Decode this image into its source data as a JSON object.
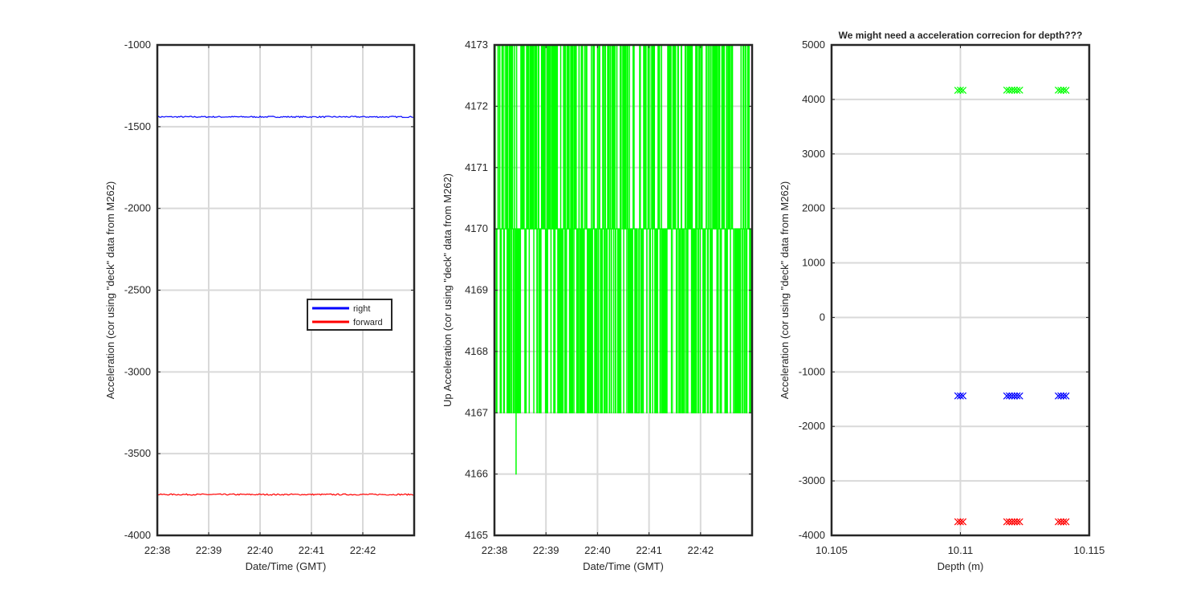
{
  "chart_data": [
    {
      "type": "line",
      "title": "",
      "xlabel": "Date/Time (GMT)",
      "ylabel": "Acceleration (cor using \"deck\" data from M262)",
      "x_ticks": [
        "22:38",
        "22:39",
        "22:40",
        "22:41",
        "22:42"
      ],
      "xlim": [
        "22:38",
        "22:43"
      ],
      "ylim": [
        -4000,
        -1000
      ],
      "y_ticks": [
        -1000,
        -1500,
        -2000,
        -2500,
        -3000,
        -3500,
        -4000
      ],
      "grid": true,
      "legend": {
        "placement": "center-right",
        "entries": [
          "right",
          "forward"
        ]
      },
      "series": [
        {
          "name": "right",
          "color": "#0000ff",
          "level": -1440,
          "x": [
            "22:38",
            "22:39",
            "22:40",
            "22:41",
            "22:42",
            "22:43"
          ],
          "values": [
            -1440,
            -1441,
            -1440,
            -1441,
            -1442,
            -1441
          ]
        },
        {
          "name": "forward",
          "color": "#ff0000",
          "level": -3750,
          "x": [
            "22:38",
            "22:39",
            "22:40",
            "22:41",
            "22:42",
            "22:43"
          ],
          "values": [
            -3750,
            -3752,
            -3750,
            -3749,
            -3751,
            -3752
          ]
        }
      ]
    },
    {
      "type": "line",
      "title": "",
      "xlabel": "Date/Time (GMT)",
      "ylabel": "Up Acceleration (cor using \"deck\" data from M262)",
      "x_ticks": [
        "22:38",
        "22:39",
        "22:40",
        "22:41",
        "22:42"
      ],
      "xlim": [
        "22:38",
        "22:43"
      ],
      "ylim": [
        4165,
        4173
      ],
      "y_ticks": [
        4173,
        4172,
        4171,
        4170,
        4169,
        4168,
        4167,
        4166,
        4165
      ],
      "grid": true,
      "series": [
        {
          "color": "#00ff00",
          "levels": [
            4167,
            4170,
            4173
          ],
          "min": 4166,
          "x": [
            "22:38",
            "22:39",
            "22:40",
            "22:41",
            "22:42",
            "22:43"
          ],
          "values": [
            4170,
            4167,
            4173,
            4170,
            4167,
            4173
          ]
        }
      ]
    },
    {
      "type": "scatter",
      "title": "We might need a acceleration correcion for depth???",
      "xlabel": "Depth (m)",
      "ylabel": "Acceleration (cor using \"deck\" data from M262)",
      "x_ticks": [
        "10.105",
        "10.11",
        "10.115"
      ],
      "xlim": [
        10.105,
        10.115
      ],
      "ylim": [
        -4000,
        5000
      ],
      "y_ticks": [
        5000,
        4000,
        3000,
        2000,
        1000,
        0,
        -1000,
        -2000,
        -3000,
        -4000
      ],
      "grid": true,
      "marker": "x",
      "series": [
        {
          "color": "#00ff00",
          "x": [
            10.1099,
            10.11,
            10.1101,
            10.1118,
            10.1119,
            10.112,
            10.1121,
            10.1122,
            10.1123,
            10.1138,
            10.1139,
            10.114,
            10.1141
          ],
          "values": [
            4167,
            4170,
            4167,
            4170,
            4167,
            4173,
            4170,
            4167,
            4170,
            4170,
            4167,
            4170,
            4167
          ]
        },
        {
          "color": "#0000ff",
          "x": [
            10.1099,
            10.11,
            10.1101,
            10.1118,
            10.1119,
            10.112,
            10.1121,
            10.1122,
            10.1123,
            10.1138,
            10.1139,
            10.114,
            10.1141
          ],
          "values": [
            -1440,
            -1441,
            -1440,
            -1441,
            -1440,
            -1442,
            -1441,
            -1440,
            -1441,
            -1441,
            -1440,
            -1442,
            -1441
          ]
        },
        {
          "color": "#ff0000",
          "x": [
            10.1099,
            10.11,
            10.1101,
            10.1118,
            10.1119,
            10.112,
            10.1121,
            10.1122,
            10.1123,
            10.1138,
            10.1139,
            10.114,
            10.1141
          ],
          "values": [
            -3750,
            -3751,
            -3750,
            -3751,
            -3750,
            -3752,
            -3751,
            -3750,
            -3751,
            -3751,
            -3750,
            -3752,
            -3751
          ]
        }
      ]
    }
  ]
}
